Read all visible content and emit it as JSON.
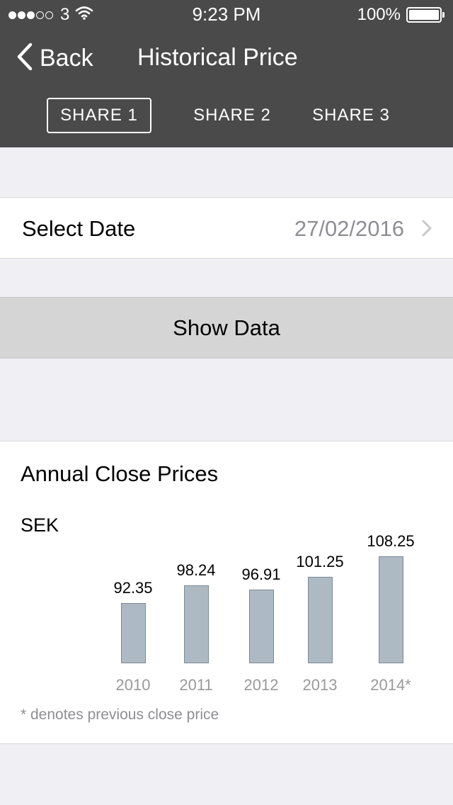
{
  "status_bar": {
    "carrier": "3",
    "time": "9:23 PM",
    "battery": "100%"
  },
  "nav": {
    "back_label": "Back",
    "title": "Historical Price"
  },
  "tabs": [
    {
      "label": "SHARE 1",
      "selected": true
    },
    {
      "label": "SHARE 2",
      "selected": false
    },
    {
      "label": "SHARE 3",
      "selected": false
    }
  ],
  "date_row": {
    "label": "Select Date",
    "value": "27/02/2016"
  },
  "show_button": {
    "label": "Show Data"
  },
  "chart_card": {
    "footnote": "* denotes previous close price"
  },
  "chart_data": {
    "type": "bar",
    "title": "Annual Close Prices",
    "ylabel": "SEK",
    "xlabel": "",
    "categories": [
      "2010",
      "2011",
      "2012",
      "2013",
      "2014*"
    ],
    "values": [
      92.35,
      98.24,
      96.91,
      101.25,
      108.25
    ],
    "value_labels": [
      "92.35",
      "98.24",
      "96.91",
      "101.25",
      "108.25"
    ],
    "bar_color": "#aebac3"
  },
  "colors": {
    "header": "#4a4a4a",
    "background": "#efeff4",
    "button": "#d5d5d5",
    "secondary_text": "#8e8e93"
  }
}
